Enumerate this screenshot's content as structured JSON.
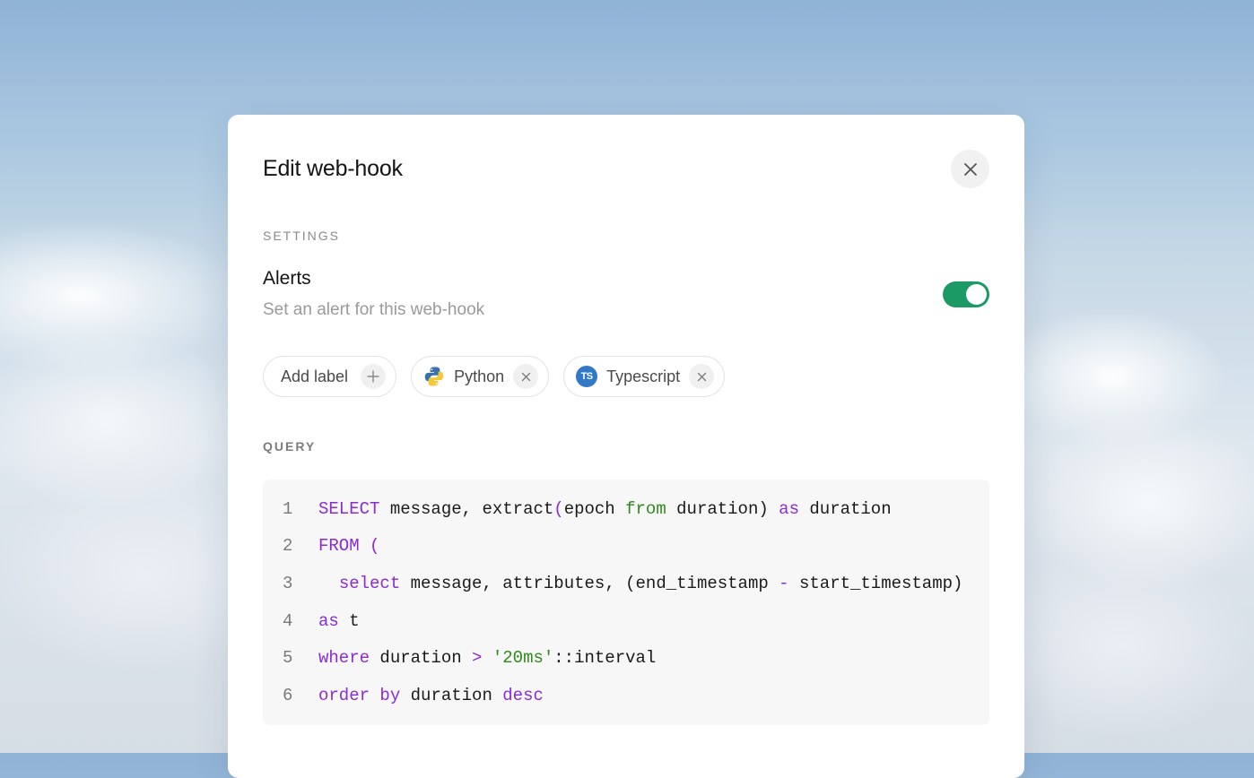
{
  "modal": {
    "title": "Edit web-hook",
    "close_icon": "close-icon"
  },
  "settings": {
    "section_label": "SETTINGS",
    "alerts_title": "Alerts",
    "alerts_description": "Set an alert for this web-hook",
    "alerts_enabled": true,
    "toggle_color": "#1c9a65"
  },
  "labels": {
    "add_label": "Add label",
    "add_icon": "plus-icon",
    "chips": [
      {
        "label": "Python",
        "icon": "python-logo-icon",
        "remove_icon": "close-icon"
      },
      {
        "label": "Typescript",
        "icon": "typescript-logo-icon",
        "logo_text": "TS",
        "remove_icon": "close-icon"
      }
    ]
  },
  "query": {
    "section_label": "QUERY",
    "lines": [
      {
        "number": "1",
        "text": "SELECT message, extract(epoch from duration) as duration"
      },
      {
        "number": "2",
        "text": "FROM ("
      },
      {
        "number": "3",
        "text": "  select message, attributes, (end_timestamp - start_timestamp)"
      },
      {
        "number": "4",
        "text": "as t"
      },
      {
        "number": "5",
        "text": "where duration > '20ms'::interval"
      },
      {
        "number": "6",
        "text": "order by duration desc"
      }
    ]
  }
}
